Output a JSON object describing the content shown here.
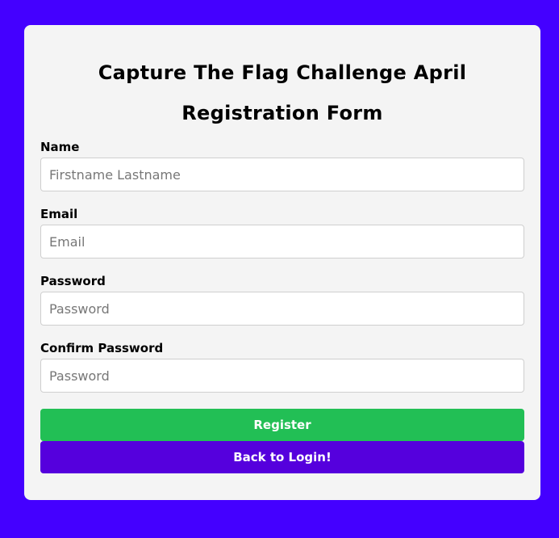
{
  "form": {
    "title_line1": "Capture The Flag Challenge April",
    "title_line2": "Registration Form",
    "fields": [
      {
        "label": "Name",
        "placeholder": "Firstname Lastname",
        "value": ""
      },
      {
        "label": "Email",
        "placeholder": "Email",
        "value": ""
      },
      {
        "label": "Password",
        "placeholder": "Password",
        "value": ""
      },
      {
        "label": "Confirm Password",
        "placeholder": "Password",
        "value": ""
      }
    ],
    "register_label": "Register",
    "back_label": "Back to Login!"
  },
  "colors": {
    "background": "#4400ff",
    "card": "#f4f4f4",
    "register_button": "#22bf55",
    "back_button": "#5500dd"
  }
}
